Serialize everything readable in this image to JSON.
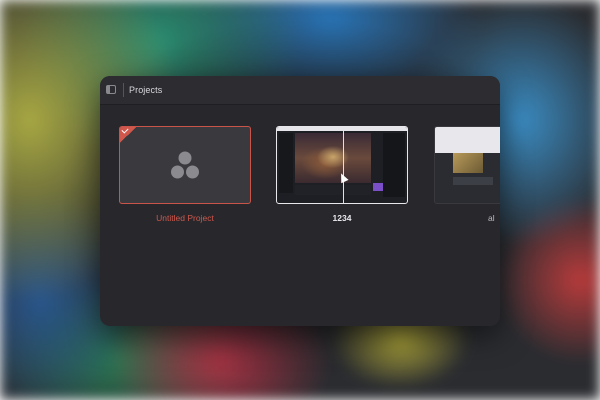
{
  "window": {
    "title": "Projects"
  },
  "projects": [
    {
      "label": "Untitled Project",
      "selected": true,
      "icon": "davinci-resolve-logo-icon"
    },
    {
      "label": "1234",
      "selected": false
    },
    {
      "label": "al",
      "selected": false
    }
  ],
  "colors": {
    "accent": "#d0574c",
    "window_bg": "#28282c"
  }
}
